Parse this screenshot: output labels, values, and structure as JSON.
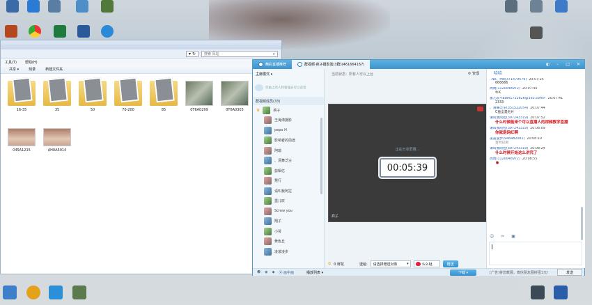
{
  "explorer": {
    "search_placeholder": "搜索 风站",
    "menu": [
      "工具(T)",
      "帮助(H)"
    ],
    "toolbar": [
      "共享 ▾",
      "刻录",
      "新建文件夹"
    ],
    "files": [
      {
        "name": "16-35",
        "kind": "folder"
      },
      {
        "name": "35",
        "kind": "folder"
      },
      {
        "name": "50",
        "kind": "folder"
      },
      {
        "name": "70-200",
        "kind": "folder"
      },
      {
        "name": "85",
        "kind": "folder"
      },
      {
        "name": "0T6A0299",
        "kind": "photo"
      },
      {
        "name": "0T6A0305",
        "kind": "photo"
      },
      {
        "name": "045A1215",
        "kind": "photo2"
      },
      {
        "name": "AH0A5914",
        "kind": "photo2"
      }
    ]
  },
  "qq": {
    "tabs": [
      "精彩直播推荐",
      "群视频·疯子摄影签(3群)(461664167)"
    ],
    "mode_label": "主席模式 ▾",
    "notice": "仅由上的人和管理员可以说话",
    "members_header": "群视频成员(33)",
    "members": [
      "疯子",
      "王海涛摄影",
      "pepo H",
      "影响者的前途",
      "阿瑜",
      "、清舞泛尘",
      "剪辑亿",
      "慧行",
      "请叫我阿拉",
      "墨儿叹",
      "Screw you",
      "翔子",
      "小琴",
      "黄色丘",
      "凌凌凌步"
    ],
    "status_text": "当前状态：所有人可以上台",
    "manage_label": "管理",
    "sharing_text": "正在分享屏幕...",
    "timer": "00:05:39",
    "video_owner": "疯子",
    "flower_count": "0 鲜花",
    "gift_to_label": "送给:",
    "gift_target": "请选择赠送对象",
    "gift_item": "么么哒",
    "gift_button": "赠送",
    "chat": {
      "top": "哈哈",
      "messages": [
        {
          "user": "..Ne、mo(371479579)",
          "time": "20:07:25",
          "text": "666666",
          "style": "normal"
        },
        {
          "user": "周周(1120048972)",
          "time": "20:07:40",
          "text": "牛X",
          "style": "normal"
        },
        {
          "user": "墨儿叹<azsh1712626@163.com>",
          "time": "20:07:41",
          "text": "2333",
          "style": "normal"
        },
        {
          "user": "、清舞泛尘(351522054)",
          "time": "20:07:44",
          "text": "C盘全是毛片",
          "style": "normal"
        },
        {
          "user": "请叫我阿拉(397243319)",
          "time": "20:07:52",
          "text": "什么时候能来个可以直播人的视频教学直播",
          "style": "red"
        },
        {
          "user": "请叫我阿拉(397243319)",
          "time": "20:08:09",
          "text": "你就是网红啊",
          "style": "red"
        },
        {
          "user": "凌凌凌步(948482081)",
          "time": "20:08:10",
          "text": "吉时已到",
          "style": "gray"
        },
        {
          "user": "请叫我阿拉(397243319)",
          "time": "20:08:24",
          "text": "什么时候开始这么讲究了",
          "style": "red"
        },
        {
          "user": "周周(1120048972)",
          "time": "20:08:55",
          "text": "🐞",
          "style": "normal"
        }
      ]
    },
    "bottom": {
      "pip_label": "⦿ 画中画",
      "playlist_label": "播放列表 ▾",
      "download_label": "下载 ▾",
      "ad": "[广告]将您教展，微信朋友圈拼团1元！",
      "send_label": "发送"
    }
  }
}
